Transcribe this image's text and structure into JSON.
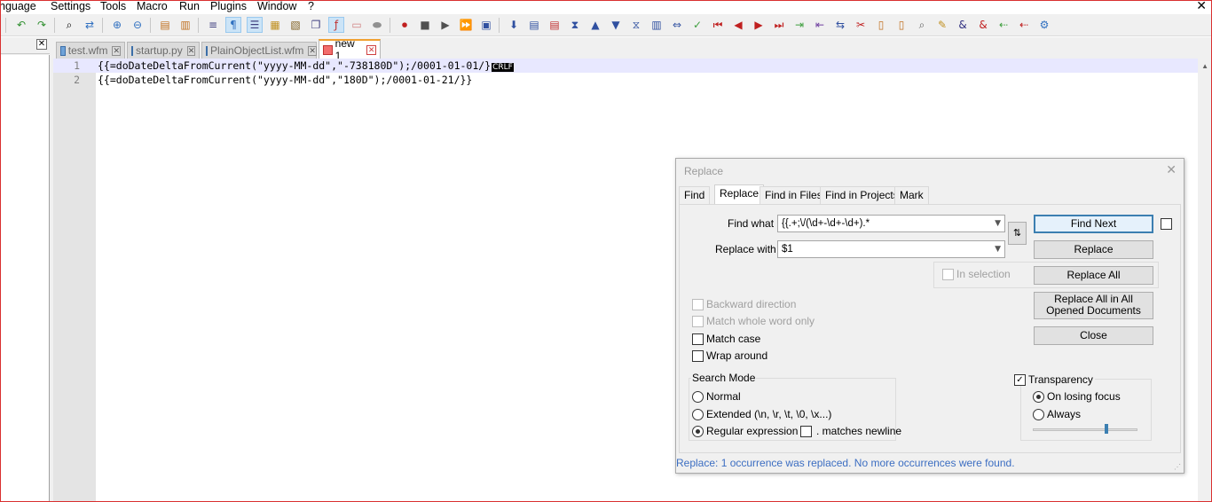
{
  "menu": {
    "items": [
      "nguage",
      "Settings",
      "Tools",
      "Macro",
      "Run",
      "Plugins",
      "Window",
      "?"
    ],
    "close_glyph": "✕"
  },
  "toolbar": {
    "icons": [
      "undo-icon",
      "redo-icon",
      "find-icon",
      "replace-icon",
      "zoom-in-icon",
      "zoom-out-icon",
      "sync-vertical-icon",
      "sync-horizontal-icon",
      "word-wrap-icon",
      "show-all-characters-icon",
      "indent-guide-icon",
      "user-defined-language-icon",
      "document-map-icon",
      "function-list-icon",
      "folder-as-workspace-icon",
      "monitoring-icon",
      "record-macro-icon",
      "stop-recording-icon",
      "play-macro-icon",
      "run-macro-multiple-icon",
      "save-macro-icon"
    ]
  },
  "tabs": [
    {
      "label": "test.wfm",
      "close": "✕"
    },
    {
      "label": "startup.py",
      "close": "✕"
    },
    {
      "label": "PlainObjectList.wfm",
      "close": "✕"
    },
    {
      "label": "new 1",
      "close": "✕"
    }
  ],
  "left_panel": {
    "close": "✕"
  },
  "editor": {
    "lines": [
      {
        "number": "1",
        "text": "{{=doDateDeltaFromCurrent(\"yyyy-MM-dd\",\"-738180D\");/0001-01-01/}",
        "eol": "CRLF"
      },
      {
        "number": "2",
        "text": "{{=doDateDeltaFromCurrent(\"yyyy-MM-dd\",\"180D\");/0001-01-21/}}",
        "eol": ""
      }
    ]
  },
  "dialog": {
    "title": "Replace",
    "close": "✕",
    "tabs": [
      "Find",
      "Replace",
      "Find in Files",
      "Find in Projects",
      "Mark"
    ],
    "find_what_label": "Find what :",
    "find_what_value": "{{.+;\\/(\\d+-\\d+-\\d+).*",
    "replace_with_label": "Replace with :",
    "replace_with_value": "$1",
    "swap_glyph": "⇅",
    "in_selection": "In selection",
    "buttons": {
      "find_next": "Find Next",
      "replace": "Replace",
      "replace_all": "Replace All",
      "replace_all_opened": "Replace All in All Opened Documents",
      "close": "Close"
    },
    "options": {
      "backward": "Backward direction",
      "whole_word": "Match whole word only",
      "match_case": "Match case",
      "wrap_around": "Wrap around"
    },
    "search_mode": {
      "title": "Search Mode",
      "normal": "Normal",
      "extended": "Extended (\\n, \\r, \\t, \\0, \\x...)",
      "regex": "Regular expression",
      "matches_newline": ". matches newline"
    },
    "transparency": {
      "title": "Transparency",
      "checked_mark": "✓",
      "on_losing_focus": "On losing focus",
      "always": "Always",
      "level_percent": 70
    },
    "status": "Replace: 1 occurrence was replaced. No more occurrences were found."
  }
}
